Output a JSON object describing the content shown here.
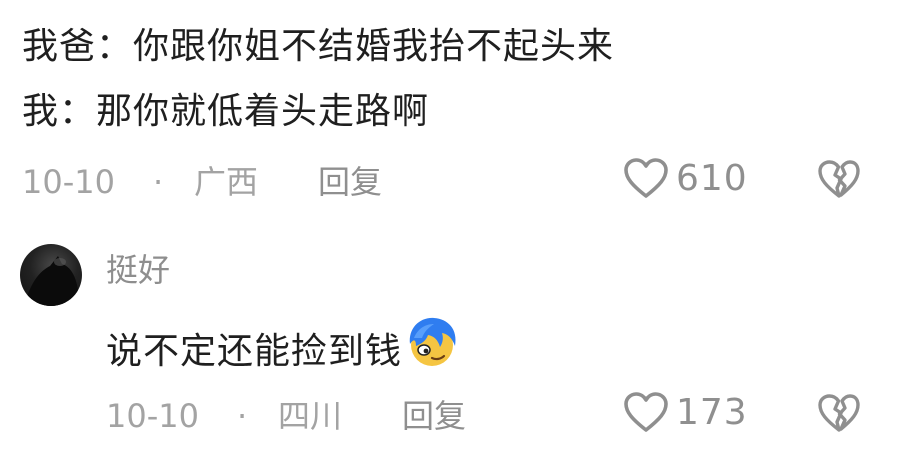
{
  "comment1": {
    "line1": "我爸：你跟你姐不结婚我抬不起头来",
    "line2": "我：那你就低着头走路啊",
    "date": "10-10",
    "separator": "·",
    "location": "广西",
    "reply_label": "回复",
    "likes": "610",
    "like_icon": "heart-outline-icon",
    "dislike_icon": "broken-heart-icon"
  },
  "comment2": {
    "username": "挺好",
    "text": "说不定还能捡到钱",
    "emoji": "blue-hair-smirk-emoji",
    "date": "10-10",
    "separator": "·",
    "location": "四川",
    "reply_label": "回复",
    "likes": "173",
    "like_icon": "heart-outline-icon",
    "dislike_icon": "broken-heart-icon"
  },
  "colors": {
    "text": "#1f1f1f",
    "meta": "#a3a3a3",
    "icon": "#8f8f8f"
  }
}
